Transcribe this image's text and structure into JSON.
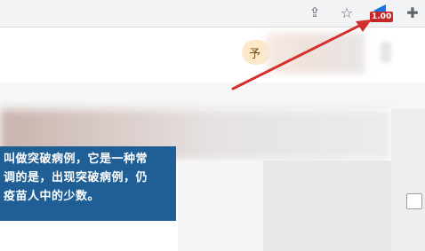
{
  "toolbar": {
    "share_icon": "share-icon",
    "bookmark_icon": "star-icon",
    "extension_badge": "1.00",
    "extensions_icon": "puzzle-icon"
  },
  "header": {
    "avatar_char": "予"
  },
  "article": {
    "selected_lines": [
      "叫做突破病例，它是一种常",
      "调的是，出现突破病例，仍",
      "疫苗人中的少数。"
    ]
  },
  "colors": {
    "selection_bg": "#1f5f95",
    "arrow": "#d32f2f",
    "badge": "#c62828"
  }
}
